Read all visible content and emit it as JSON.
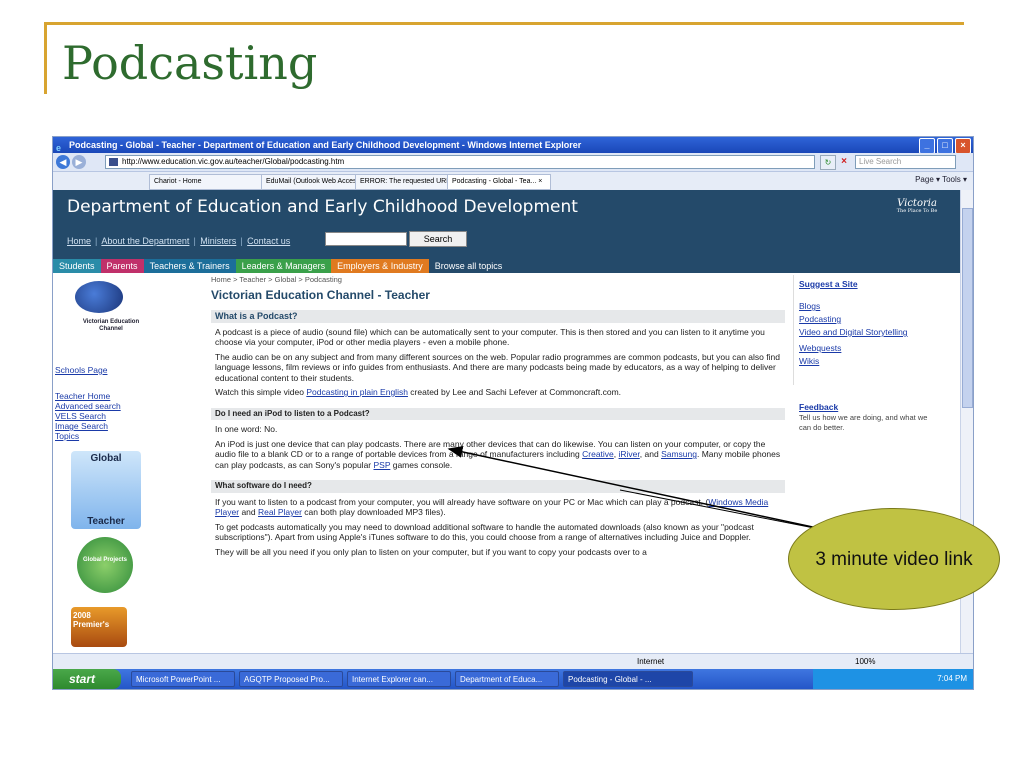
{
  "slide": {
    "title": "Podcasting"
  },
  "browser": {
    "window_title": "Podcasting - Global - Teacher - Department of Education and Early Childhood Development - Windows Internet Explorer",
    "address": "http://www.education.vic.gov.au/teacher/Global/podcasting.htm",
    "search_placeholder": "Live Search",
    "tabs": [
      {
        "label": "Chariot - Home"
      },
      {
        "label": "EduMail (Outlook Web Access)"
      },
      {
        "label": "ERROR: The requested URL ..."
      },
      {
        "label": "Podcasting - Global - Tea... ×"
      }
    ],
    "tools": "Page ▾  Tools ▾"
  },
  "site": {
    "title": "Department of Education and Early Childhood Development",
    "top_links": [
      "Home",
      "About the Department",
      "Ministers",
      "Contact us"
    ],
    "search_button": "Search",
    "logo_main": "Victoria",
    "logo_tag": "The Place To Be",
    "nav": [
      {
        "label": "Students",
        "bg": "#2a8ca8"
      },
      {
        "label": "Parents",
        "bg": "#c0306a"
      },
      {
        "label": "Teachers & Trainers",
        "bg": "#1c6e9a"
      },
      {
        "label": "Leaders & Managers",
        "bg": "#3aa04a"
      },
      {
        "label": "Employers & Industry",
        "bg": "#e07a20"
      },
      {
        "label": "Browse all topics",
        "bg": "#244a6a"
      }
    ]
  },
  "left": {
    "logo_text": "Victorian Education Channel",
    "links": [
      "Schools Page",
      "Teacher Home",
      "Advanced search",
      "VELS Search",
      "Image Search",
      "Topics"
    ],
    "global_top": "Global",
    "global_bottom": "Teacher",
    "gp_text": "Global Projects",
    "award_text": "2008 Premier's"
  },
  "main": {
    "breadcrumb": "Home > Teacher > Global > Podcasting",
    "heading": "Victorian Education Channel - Teacher",
    "s1_title": "What is a Podcast?",
    "s1_p1": "A podcast is a piece of audio (sound file) which can be automatically sent to your computer. This is then stored and you can listen to it anytime you choose via your computer, iPod or other media players - even a mobile phone.",
    "s1_p2": "The audio can be on any subject and from many different sources on the web. Popular radio programmes are common podcasts, but you can also find language lessons, film reviews or info guides from enthusiasts. And there are many podcasts being made by educators, as a way of helping to deliver educational content to their students.",
    "s1_p3_pre": "Watch this simple video ",
    "s1_p3_link": "Podcasting in plain English",
    "s1_p3_post": " created by Lee and Sachi Lefever at Commoncraft.com.",
    "s2_title": "Do I need an iPod to listen to a Podcast?",
    "s2_p1": "In one word: No.",
    "s2_p2_pre": "An iPod is just one device that can play podcasts. There are many other devices that can do likewise. You can listen on your computer, or copy the audio file to a blank CD or to a range of portable devices from a range of manufacturers including ",
    "s2_l1": "Creative",
    "s2_sep1": ", ",
    "s2_l2": "iRiver",
    "s2_sep2": ", and ",
    "s2_l3": "Samsung",
    "s2_mid": ". Many mobile phones can play podcasts, as can Sony's popular ",
    "s2_l4": "PSP",
    "s2_end": " games console.",
    "s3_title": "What software do I need?",
    "s3_p1_pre": "If you want to listen to a podcast from your computer, you will already have software on your PC or Mac which can play a podcast, (",
    "s3_l1": "Windows Media Player",
    "s3_and": " and ",
    "s3_l2": "Real Player",
    "s3_p1_post": " can both play downloaded MP3 files).",
    "s3_p2": "To get podcasts automatically you may need to download additional software to handle the automated downloads (also known as your \"podcast subscriptions\"). Apart from using Apple's iTunes software to do this, you could choose from a range of alternatives including Juice and Doppler.",
    "s3_p3": "They will be all you need if you only plan to listen on your computer, but if you want to copy your podcasts over to a"
  },
  "right": {
    "suggest": "Suggest a Site",
    "links": [
      "Blogs",
      "Podcasting",
      "Video and Digital Storytelling",
      "Webquests",
      "Wikis"
    ],
    "feedback": "Feedback",
    "feedback_desc": "Tell us how we are doing, and what we can do better."
  },
  "status": {
    "zone": "Internet",
    "zoom": "100%"
  },
  "taskbar": {
    "start": "start",
    "tasks": [
      "Microsoft PowerPoint ...",
      "AGQTP Proposed Pro...",
      "Internet Explorer can...",
      "Department of Educa...",
      "Podcasting - Global - ..."
    ],
    "clock": "7:04 PM"
  },
  "callout": {
    "text": "3 minute video link"
  },
  "colors": {
    "accent": "#d8a430",
    "title": "#2e6b2e",
    "callout": "#c0c243",
    "banner": "#244a6a"
  }
}
